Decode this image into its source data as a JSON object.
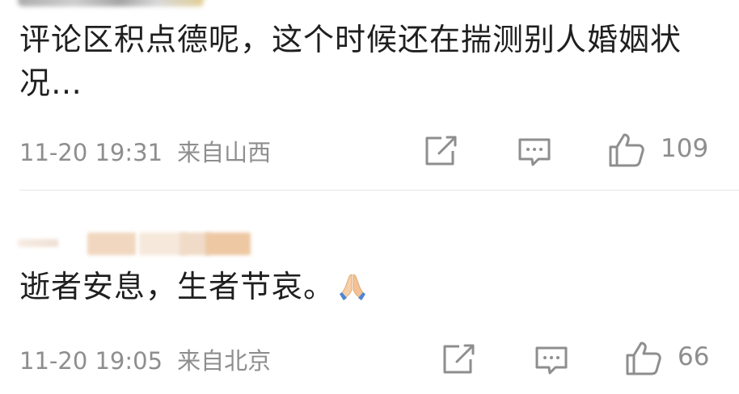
{
  "comments": [
    {
      "text": "评论区积点德呢，这个时候还在揣测别人婚姻状况…",
      "time": "11-20 19:31",
      "location": "来自山西",
      "likes": "109"
    },
    {
      "text": "逝者安息，生者节哀。",
      "emoji_icon": "folded-hands-icon",
      "time": "11-20 19:05",
      "location": "来自北京",
      "likes": "66"
    }
  ],
  "icons": {
    "share": "share-icon",
    "reply": "comment-icon",
    "like": "thumbs-up-icon"
  },
  "colors": {
    "text": "#1f1f1f",
    "meta": "#8e8e8e",
    "divider": "#e6e6e6"
  }
}
